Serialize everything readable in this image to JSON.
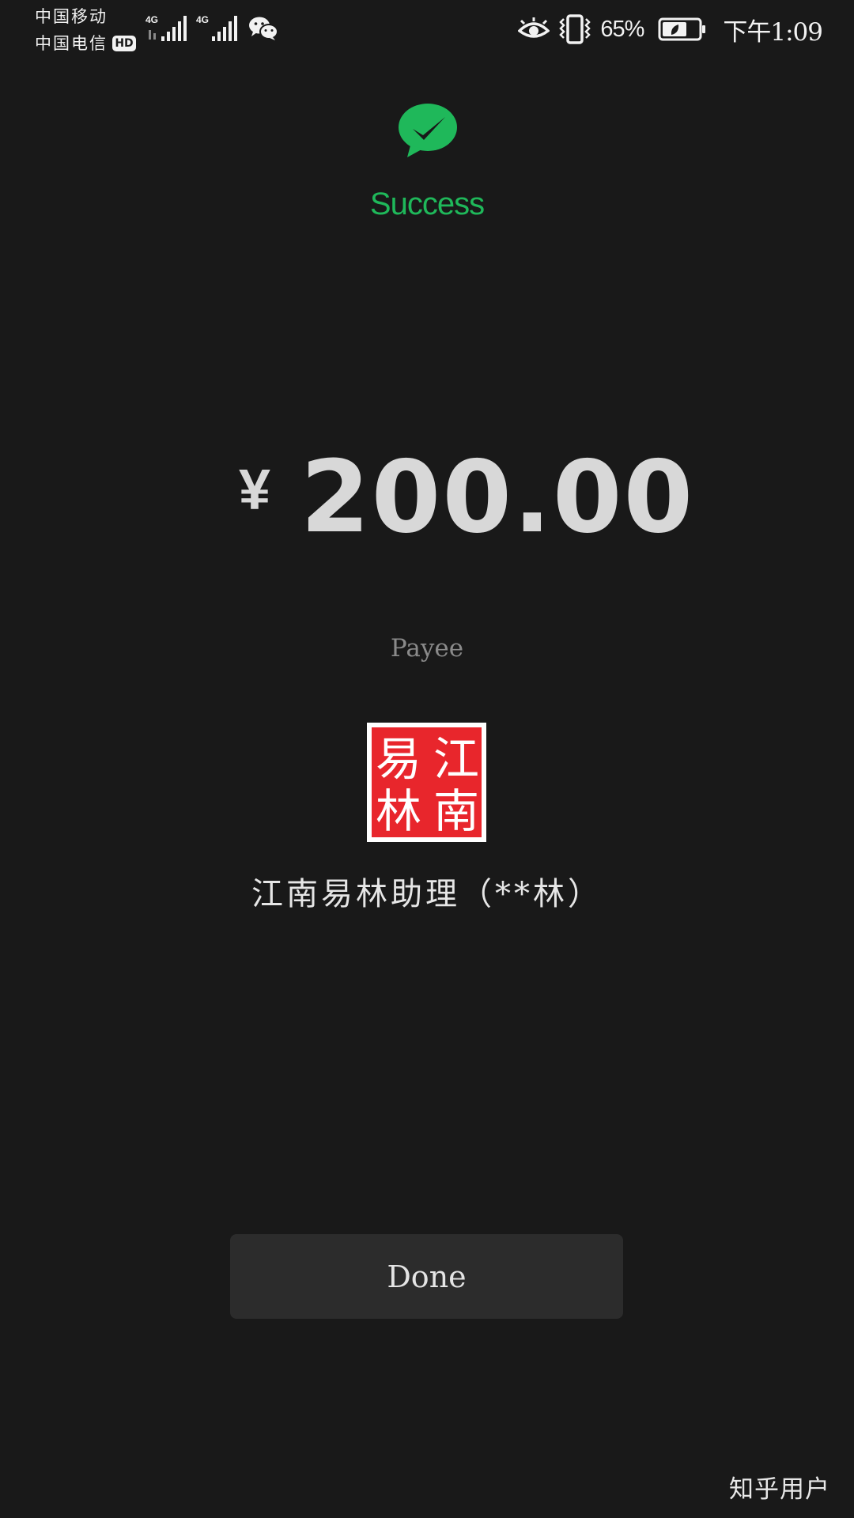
{
  "status_bar": {
    "carrier_1": "中国移动",
    "carrier_2": "中国电信",
    "hd_badge": "HD",
    "network_1": "4G",
    "network_2": "4G",
    "battery_percent": "65%",
    "time": "下午1:09",
    "icons": [
      "signal-icon",
      "wechat-icon",
      "eye-icon",
      "vibrate-icon",
      "battery-icon"
    ]
  },
  "result": {
    "status": "Success",
    "status_color": "#1fb85a",
    "icon": "success-check-icon"
  },
  "payment": {
    "currency_symbol": "¥",
    "amount": "200.00"
  },
  "payee": {
    "label": "Payee",
    "seal_text": [
      "江",
      "南",
      "易",
      "林"
    ],
    "seal_color": "#e8262c",
    "name": "江南易林助理（**林）"
  },
  "actions": {
    "done_label": "Done"
  },
  "watermark": "知乎用户"
}
